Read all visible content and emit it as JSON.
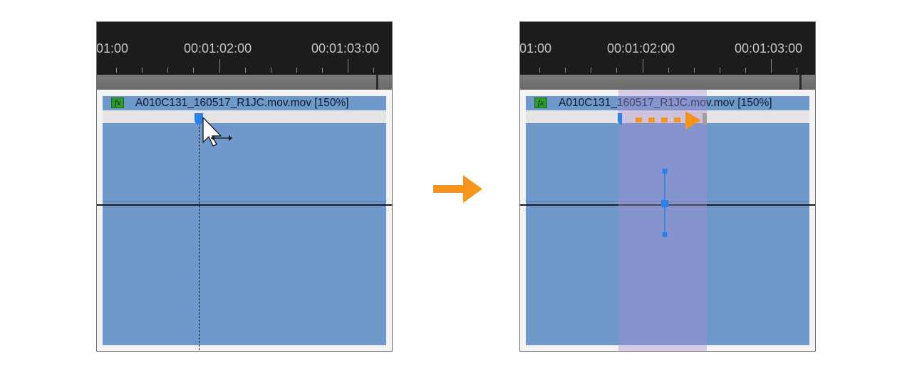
{
  "left_panel": {
    "ruler": {
      "timecodes": [
        "01:00",
        "00:01:02:00",
        "00:01:03:00"
      ]
    },
    "clip": {
      "fx_badge": "fx",
      "title": "A010C131_160517_R1JC.mov.mov [150%]"
    }
  },
  "right_panel": {
    "ruler": {
      "timecodes": [
        "01:00",
        "00:01:02:00",
        "00:01:03:00"
      ]
    },
    "clip": {
      "fx_badge": "fx",
      "title": "A010C131_160517_R1JC.mov.mov [150%]"
    }
  },
  "colors": {
    "clip_blue": "#7099cb",
    "ruler_bg": "#1c1c1c",
    "accent_orange": "#f7941d",
    "keyframe_blue": "#2a82e8",
    "fx_green": "#2e9a2e"
  },
  "icons": {
    "cursor": "pointer-with-horizontal-resize-arrow",
    "drag": "dotted-orange-right-arrow",
    "transition": "orange-right-arrow",
    "keyframe": "vertical-keyframe-handle"
  }
}
